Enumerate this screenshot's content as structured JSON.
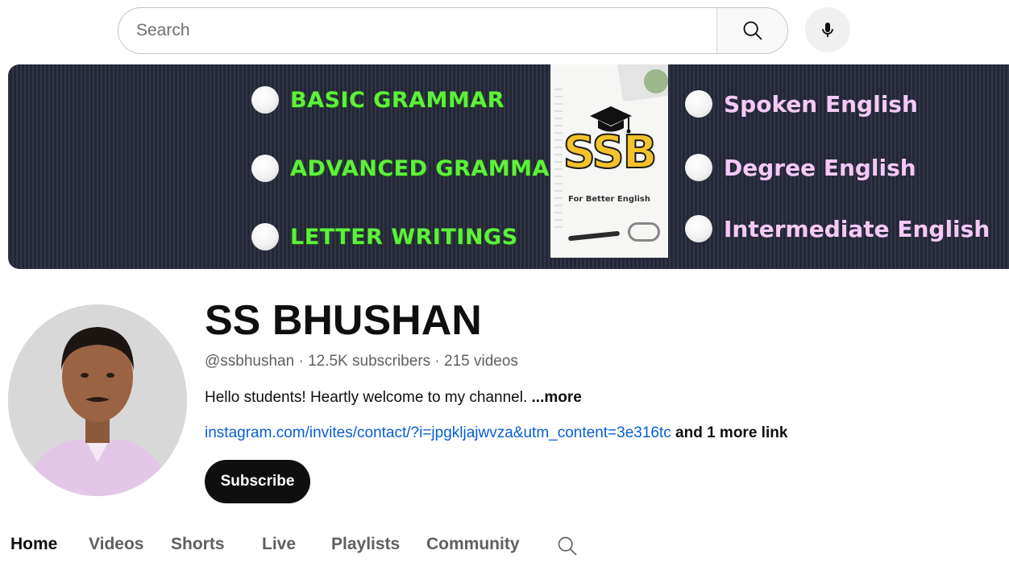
{
  "search": {
    "placeholder": "Search"
  },
  "banner": {
    "left_items": [
      "BASIC GRAMMAR",
      "ADVANCED GRAMMAR",
      "LETTER WRITINGS"
    ],
    "right_items": [
      "Spoken English",
      "Degree English",
      "Intermediate English"
    ],
    "logo_text": "SSB",
    "logo_tagline": "For Better English",
    "left_color": "#5ef03b",
    "right_color": "#f4c9f7",
    "bg_color": "#262a3b"
  },
  "channel": {
    "name": "SS BHUSHAN",
    "meta": "@ssbhushan · 12.5K subscribers · 215 videos",
    "description": "Hello students! Heartly welcome to my channel. ",
    "description_more": "...more",
    "link": "instagram.com/invites/contact/?i=jpgkljajwvza&utm_content=3e316tc",
    "more_links": " and 1 more link",
    "subscribe_label": "Subscribe"
  },
  "tabs": [
    "Home",
    "Videos",
    "Shorts",
    "Live",
    "Playlists",
    "Community"
  ],
  "icons": {
    "search": "search-icon",
    "mic": "mic-icon",
    "tab_search": "search-icon",
    "avatar": "avatar",
    "cap": "graduation-cap-icon"
  }
}
